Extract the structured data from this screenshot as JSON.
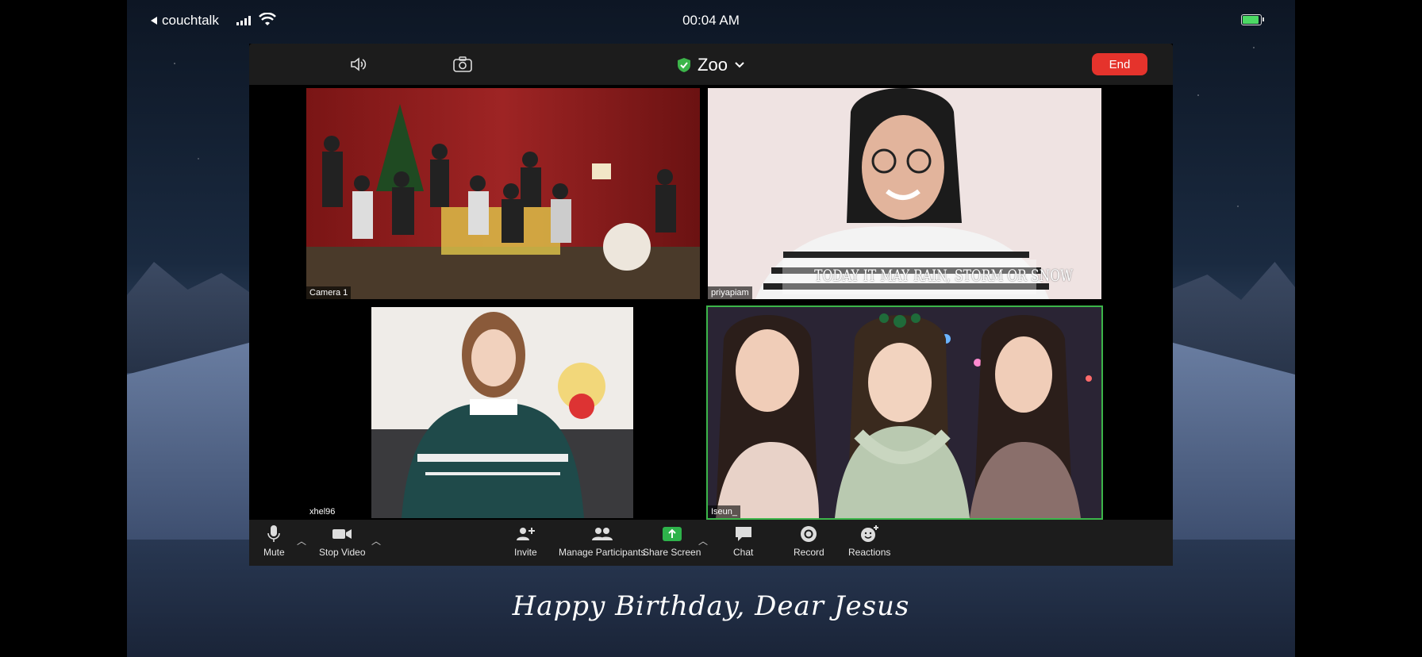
{
  "status_bar": {
    "back_label": "couchtalk",
    "time": "00:04 AM"
  },
  "meeting": {
    "title": "Zoo",
    "end_label": "End"
  },
  "tiles": [
    {
      "name": "Camera 1"
    },
    {
      "name": "priyapiam",
      "overlay_text": "TODAY IT MAY RAIN, STORM OR SNOW"
    },
    {
      "name": "xhel96"
    },
    {
      "name": "Iseun_"
    }
  ],
  "toolbar": {
    "mute": "Mute",
    "stop_video": "Stop Video",
    "invite": "Invite",
    "manage_participants": "Manage Participants",
    "share_screen": "Share Screen",
    "chat": "Chat",
    "record": "Record",
    "reactions": "Reactions"
  },
  "caption": "Happy Birthday, Dear Jesus",
  "colors": {
    "end_button": "#e5332c",
    "active_speaker": "#3cb54a",
    "share_screen": "#2eb34b",
    "shield": "#3cb54a"
  },
  "icons": [
    "speaker-icon",
    "camera-flip-icon",
    "shield-icon",
    "chevron-down-icon",
    "mic-icon",
    "video-icon",
    "add-person-icon",
    "participants-icon",
    "share-arrow-icon",
    "chat-bubble-icon",
    "record-icon",
    "smiley-plus-icon"
  ]
}
